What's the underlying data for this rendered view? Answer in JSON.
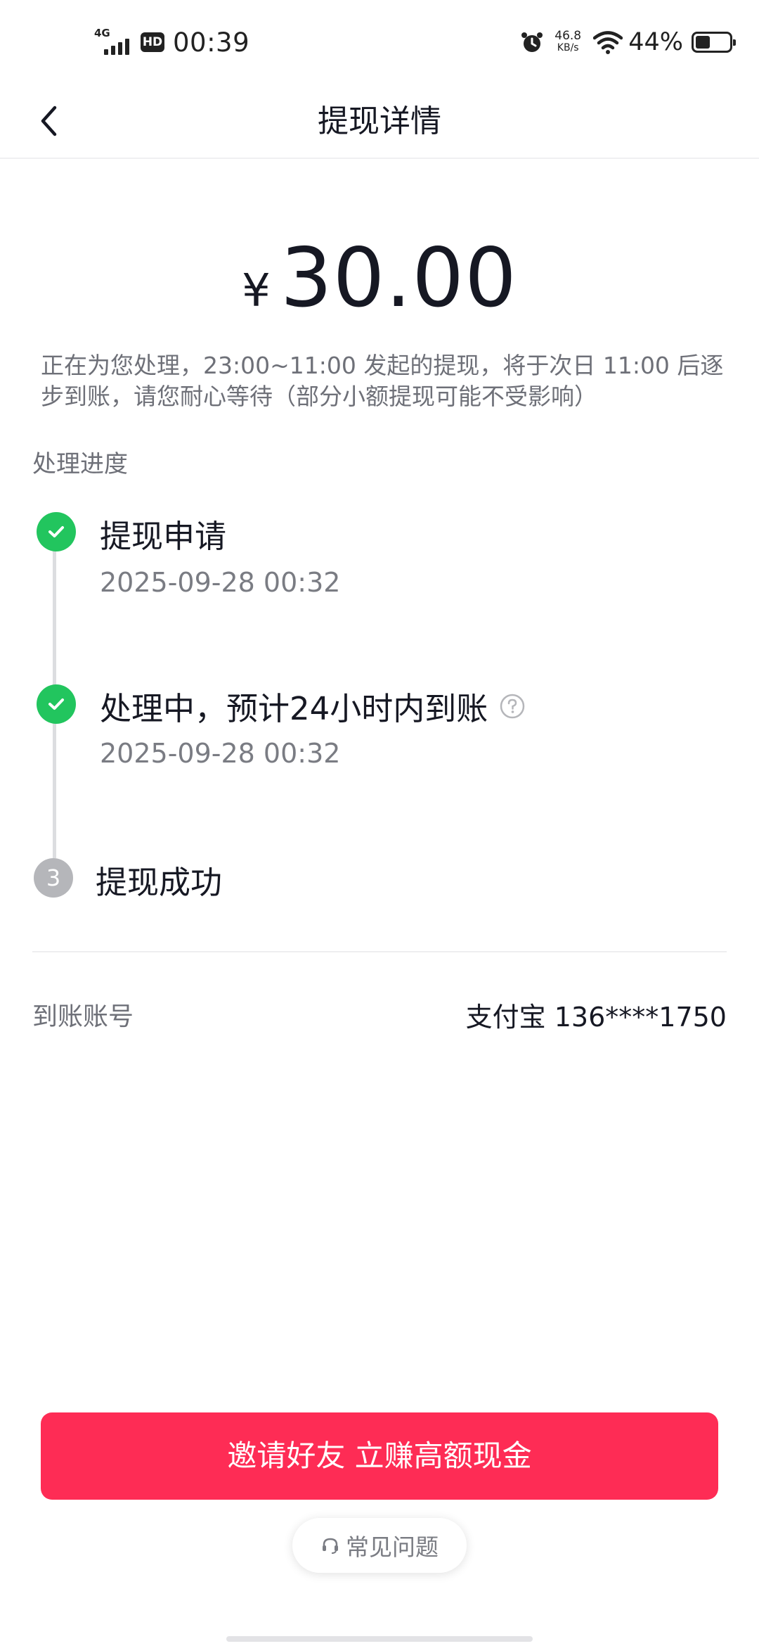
{
  "status_bar": {
    "network": "4G",
    "hd": "HD",
    "time": "00:39",
    "speed_value": "46.8",
    "speed_unit": "KB/s",
    "battery_percent": "44%",
    "battery_level": 0.44
  },
  "nav": {
    "title": "提现详情",
    "back_icon": "chevron-left-icon"
  },
  "amount": {
    "symbol": "¥",
    "value": "30.00"
  },
  "notice": "正在为您处理，23:00~11:00 发起的提现，将于次日 11:00 后逐步到账，请您耐心等待（部分小额提现可能不受影响）",
  "progress": {
    "label": "处理进度",
    "steps": [
      {
        "title": "提现申请",
        "time": "2025-09-28 00:32",
        "status": "done"
      },
      {
        "title": "处理中，预计24小时内到账",
        "time": "2025-09-28 00:32",
        "status": "done",
        "has_help_icon": true
      },
      {
        "title": "提现成功",
        "number": "3",
        "status": "pending"
      }
    ]
  },
  "account": {
    "label": "到账账号",
    "value": "支付宝 136****1750"
  },
  "invite_button": "邀请好友 立赚高额现金",
  "faq_button": "常见问题",
  "colors": {
    "accent": "#fe2c55",
    "success": "#22c55e",
    "pending": "#b5b6ba",
    "text_primary": "#161823",
    "text_secondary": "#7a7c83"
  }
}
